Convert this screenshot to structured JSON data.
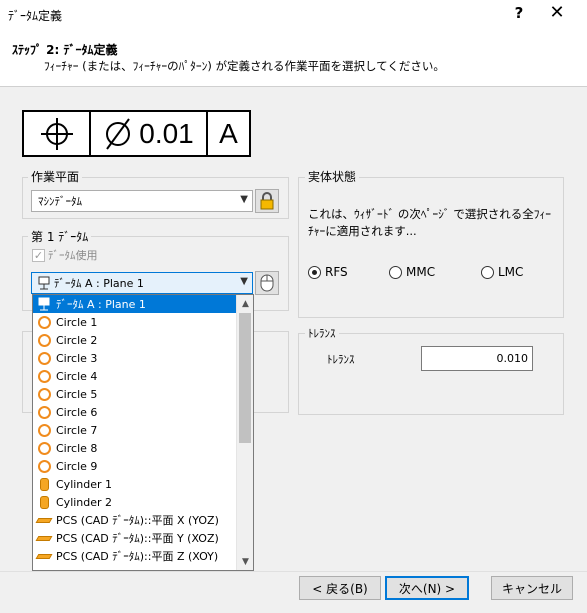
{
  "window": {
    "title": "ﾃﾞｰﾀﾑ定義",
    "help": "?",
    "close": "✕"
  },
  "header": {
    "step": "ｽﾃｯﾌﾟ 2: ﾃﾞｰﾀﾑ定義",
    "description": "ﾌｨｰﾁｬｰ (または、ﾌｨｰﾁｬｰのﾊﾟﾀｰﾝ) が定義される作業平面を選択してください。"
  },
  "fcf": {
    "value": "0.01",
    "datum": "A",
    "diameter_symbol": "⌀"
  },
  "work_plane": {
    "label": "作業平面",
    "selected": "ﾏｼﾝﾃﾞｰﾀﾑ",
    "lock_icon": "lock-icon"
  },
  "material_condition": {
    "label": "実体状態",
    "description": "これは、ｳｨｻﾞｰﾄﾞ の次ﾍﾟｰｼﾞ で選択される全ﾌｨｰﾁｬｰに適用されます...",
    "options": [
      "RFS",
      "MMC",
      "LMC"
    ],
    "selected": "RFS"
  },
  "datum1": {
    "label": "第 1 ﾃﾞｰﾀﾑ",
    "use_checkbox_label": "ﾃﾞｰﾀﾑ使用",
    "use_checked": true,
    "selected": "ﾃﾞｰﾀﾑ A : Plane 1",
    "items": [
      {
        "label": "ﾃﾞｰﾀﾑ A : Plane 1",
        "icon": "datum-icon"
      },
      {
        "label": "Circle 1",
        "icon": "circle-icon"
      },
      {
        "label": "Circle 2",
        "icon": "circle-icon"
      },
      {
        "label": "Circle 3",
        "icon": "circle-icon"
      },
      {
        "label": "Circle 4",
        "icon": "circle-icon"
      },
      {
        "label": "Circle 5",
        "icon": "circle-icon"
      },
      {
        "label": "Circle 6",
        "icon": "circle-icon"
      },
      {
        "label": "Circle 7",
        "icon": "circle-icon"
      },
      {
        "label": "Circle 8",
        "icon": "circle-icon"
      },
      {
        "label": "Circle 9",
        "icon": "circle-icon"
      },
      {
        "label": "Cylinder 1",
        "icon": "cylinder-icon"
      },
      {
        "label": "Cylinder 2",
        "icon": "cylinder-icon"
      },
      {
        "label": "PCS (CAD ﾃﾞｰﾀﾑ)::平面 X (YOZ)",
        "icon": "plane-icon"
      },
      {
        "label": "PCS (CAD ﾃﾞｰﾀﾑ)::平面 Y (XOZ)",
        "icon": "plane-icon"
      },
      {
        "label": "PCS (CAD ﾃﾞｰﾀﾑ)::平面 Z (XOY)",
        "icon": "plane-icon"
      }
    ]
  },
  "tolerance": {
    "label": "ﾄﾚﾗﾝｽ",
    "field_label": "ﾄﾚﾗﾝｽ",
    "value": "0.010"
  },
  "buttons": {
    "back": "< 戻る(B)",
    "next": "次へ(N) >",
    "cancel": "キャンセル"
  }
}
